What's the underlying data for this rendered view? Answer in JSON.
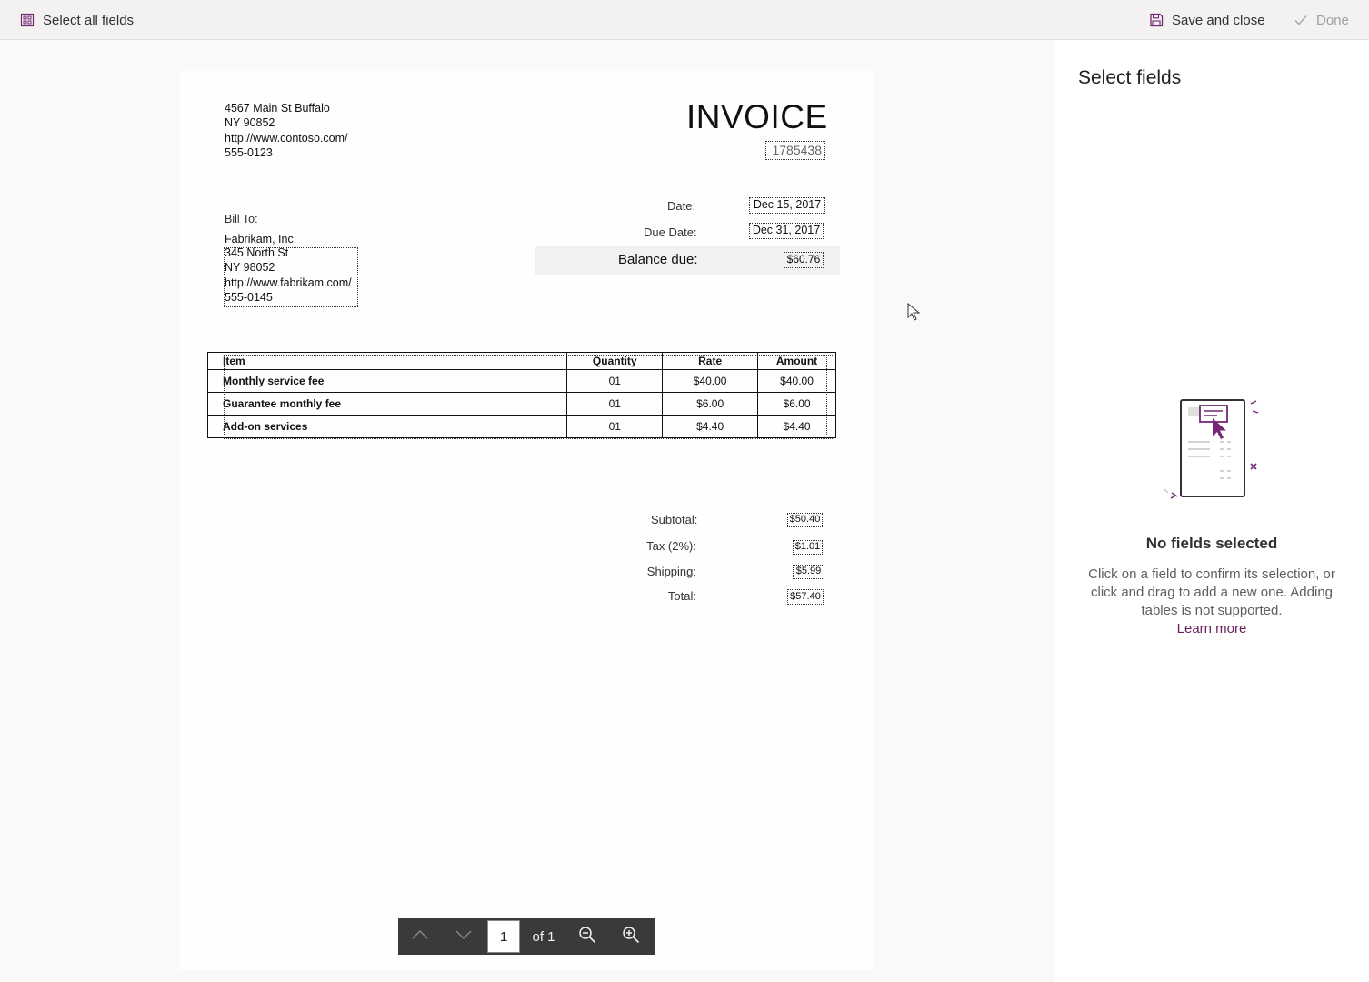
{
  "toolbar": {
    "select_all_label": "Select all fields",
    "save_close_label": "Save and close",
    "done_label": "Done"
  },
  "invoice": {
    "sender": [
      "4567 Main St Buffalo",
      "NY 90852",
      "http://www.contoso.com/",
      "555-0123"
    ],
    "title": "INVOICE",
    "number": "1785438",
    "bill_to_label": "Bill To:",
    "bill_to": [
      "Fabrikam, Inc.",
      "345 North St",
      "NY 98052",
      "http://www.fabrikam.com/",
      "555-0145"
    ],
    "date_label": "Date:",
    "date_value": "Dec 15, 2017",
    "due_date_label": "Due Date:",
    "due_date_value": "Dec 31, 2017",
    "balance_label": "Balance due:",
    "balance_value": "$60.76",
    "table": {
      "headers": [
        "Item",
        "Quantity",
        "Rate",
        "Amount"
      ],
      "rows": [
        [
          "Monthly service fee",
          "01",
          "$40.00",
          "$40.00"
        ],
        [
          "Guarantee monthly fee",
          "01",
          "$6.00",
          "$6.00"
        ],
        [
          "Add-on services",
          "01",
          "$4.40",
          "$4.40"
        ]
      ]
    },
    "totals": [
      {
        "label": "Subtotal:",
        "value": "$50.40"
      },
      {
        "label": "Tax (2%):",
        "value": "$1.01"
      },
      {
        "label": "Shipping:",
        "value": "$5.99"
      },
      {
        "label": "Total:",
        "value": "$57.40"
      }
    ]
  },
  "pager": {
    "page": "1",
    "of_label": "of 1"
  },
  "panel": {
    "title": "Select fields",
    "empty_title": "No fields selected",
    "empty_desc": "Click on a field to confirm its selection, or click and drag to add a new one. Adding tables is not supported.",
    "learn_more": "Learn more"
  },
  "colors": {
    "accent": "#742774",
    "topbar_bg": "#f3f2f1",
    "pager_bg": "#3b3a39"
  },
  "icons": [
    "select-all-icon",
    "save-icon",
    "checkmark-icon",
    "chevron-up-icon",
    "chevron-down-icon",
    "zoom-out-icon",
    "zoom-in-icon",
    "mouse-pointer-icon",
    "document-illustration"
  ]
}
